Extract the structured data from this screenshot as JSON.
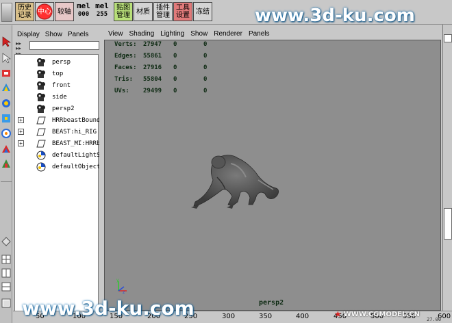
{
  "shelf": {
    "buttons": [
      {
        "label": "历史\n记录",
        "bg": "#d9c08a"
      },
      {
        "label": "中心",
        "bg": "#cc2020"
      },
      {
        "label": "较轴",
        "bg": "#e8c8c8"
      },
      {
        "label": "贴图\n管理",
        "bg": "#b9e07a"
      },
      {
        "label": "材质",
        "bg": "#d4d4d4"
      },
      {
        "label": "插件\n管理",
        "bg": "#d4d4d4"
      },
      {
        "label": "工具\n设置",
        "bg": "#e07a7a"
      },
      {
        "label": "冻结",
        "bg": "#d4d4d4"
      }
    ],
    "mel": [
      {
        "top": "mel",
        "bottom": "000"
      },
      {
        "top": "mel",
        "bottom": "255"
      }
    ]
  },
  "watermarks": {
    "top": "www.3d-ku.com",
    "bottom": "www.3d-ku.com",
    "corner": "WWW.CGMODEL.CN"
  },
  "outliner": {
    "menu": [
      "Display",
      "Show",
      "Panels"
    ],
    "items": [
      {
        "label": "persp",
        "icon": "camera-icon",
        "expand": false
      },
      {
        "label": "top",
        "icon": "camera-icon",
        "expand": false
      },
      {
        "label": "front",
        "icon": "camera-icon",
        "expand": false
      },
      {
        "label": "side",
        "icon": "camera-icon",
        "expand": false
      },
      {
        "label": "persp2",
        "icon": "camera-icon",
        "expand": false
      },
      {
        "label": "HRRbeastBound",
        "icon": "transform-icon",
        "expand": true
      },
      {
        "label": "BEAST:hi_RIG",
        "icon": "transform-icon",
        "expand": true
      },
      {
        "label": "BEAST_MI:HRRb",
        "icon": "transform-icon",
        "expand": true
      },
      {
        "label": "defaultLightSet",
        "icon": "set-icon",
        "expand": false
      },
      {
        "label": "defaultObjectSet",
        "icon": "set-icon",
        "expand": false
      }
    ]
  },
  "viewport": {
    "menu": [
      "View",
      "Shading",
      "Lighting",
      "Show",
      "Renderer",
      "Panels"
    ],
    "hud": [
      {
        "key": "Verts:",
        "v1": "27947",
        "v2": "0",
        "v3": "0"
      },
      {
        "key": "Edges:",
        "v1": "55861",
        "v2": "0",
        "v3": "0"
      },
      {
        "key": "Faces:",
        "v1": "27916",
        "v2": "0",
        "v3": "0"
      },
      {
        "key": "Tris:",
        "v1": "55804",
        "v2": "0",
        "v3": "0"
      },
      {
        "key": "UVs:",
        "v1": "29499",
        "v2": "0",
        "v3": "0"
      }
    ],
    "camera": "persp2",
    "bg_color": "#8e8e8e"
  },
  "timeline": {
    "ticks": [
      "50",
      "100",
      "150",
      "200",
      "250",
      "300",
      "350",
      "400",
      "450",
      "500",
      "550",
      "600"
    ],
    "current": "27.00"
  }
}
